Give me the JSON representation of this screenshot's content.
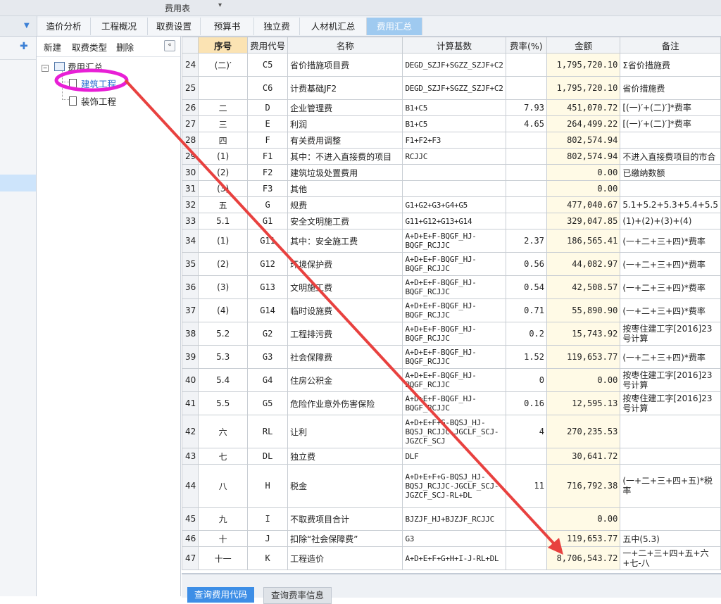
{
  "window": {
    "title": "费用表"
  },
  "tabs": [
    {
      "label": "造价分析"
    },
    {
      "label": "工程概况"
    },
    {
      "label": "取费设置"
    },
    {
      "label": "预算书"
    },
    {
      "label": "独立费"
    },
    {
      "label": "人材机汇总"
    },
    {
      "label": "费用汇总",
      "active": true
    }
  ],
  "tree_toolbar": {
    "new": "新建",
    "fee_type": "取费类型",
    "delete": "删除"
  },
  "tree": {
    "root": "费用汇总",
    "children": [
      "建筑工程",
      "装饰工程"
    ],
    "selected": "建筑工程"
  },
  "table": {
    "headers": [
      "序号",
      "费用代号",
      "名称",
      "计算基数",
      "费率(%)",
      "金额",
      "备注"
    ],
    "rows": [
      {
        "n": "24",
        "seq": "(二)′",
        "code": "C5",
        "name": "省价措施项目费",
        "base": "DEGD_SZJF+SGZZ_SZJF+C2",
        "rate": "",
        "amount": "1,795,720.10",
        "note": "Σ省价措施费"
      },
      {
        "n": "25",
        "seq": "",
        "code": "C6",
        "name": "计费基础JF2",
        "base": "DEGD_SZJF+SGZZ_SZJF+C2",
        "rate": "",
        "amount": "1,795,720.10",
        "note": "省价措施费"
      },
      {
        "n": "26",
        "seq": "二",
        "code": "D",
        "name": "企业管理费",
        "base": "B1+C5",
        "rate": "7.93",
        "amount": "451,070.72",
        "note": "[(一)′+(二)′]*费率"
      },
      {
        "n": "27",
        "seq": "三",
        "code": "E",
        "name": "利润",
        "base": "B1+C5",
        "rate": "4.65",
        "amount": "264,499.22",
        "note": "[(一)′+(二)′]*费率"
      },
      {
        "n": "28",
        "seq": "四",
        "code": "F",
        "name": "有关费用调整",
        "base": "F1+F2+F3",
        "rate": "",
        "amount": "802,574.94",
        "note": ""
      },
      {
        "n": "29",
        "seq": "(1)",
        "code": "F1",
        "name": "其中：不进入直接费的项目",
        "base": "RCJJC",
        "rate": "",
        "amount": "802,574.94",
        "note": "不进入直接费项目的市合"
      },
      {
        "n": "30",
        "seq": "(2)",
        "code": "F2",
        "name": "建筑垃圾处置费用",
        "base": "",
        "rate": "",
        "amount": "0.00",
        "note": "已缴纳数额"
      },
      {
        "n": "31",
        "seq": "(3)",
        "code": "F3",
        "name": "其他",
        "base": "",
        "rate": "",
        "amount": "0.00",
        "note": ""
      },
      {
        "n": "32",
        "seq": "五",
        "code": "G",
        "name": "规费",
        "base": "G1+G2+G3+G4+G5",
        "rate": "",
        "amount": "477,040.67",
        "note": "5.1+5.2+5.3+5.4+5.5"
      },
      {
        "n": "33",
        "seq": "5.1",
        "code": "G1",
        "name": "安全文明施工费",
        "base": "G11+G12+G13+G14",
        "rate": "",
        "amount": "329,047.85",
        "note": "(1)+(2)+(3)+(4)"
      },
      {
        "n": "34",
        "seq": "(1)",
        "code": "G11",
        "name": "其中：安全施工费",
        "base": "A+D+E+F-BQGF_HJ-BQGF_RCJJC",
        "rate": "2.37",
        "amount": "186,565.41",
        "note": "(一+二+三+四)*费率"
      },
      {
        "n": "35",
        "seq": "(2)",
        "code": "G12",
        "name": "环境保护费",
        "base": "A+D+E+F-BQGF_HJ-BQGF_RCJJC",
        "rate": "0.56",
        "amount": "44,082.97",
        "note": "(一+二+三+四)*费率"
      },
      {
        "n": "36",
        "seq": "(3)",
        "code": "G13",
        "name": "文明施工费",
        "base": "A+D+E+F-BQGF_HJ-BQGF_RCJJC",
        "rate": "0.54",
        "amount": "42,508.57",
        "note": "(一+二+三+四)*费率"
      },
      {
        "n": "37",
        "seq": "(4)",
        "code": "G14",
        "name": "临时设施费",
        "base": "A+D+E+F-BQGF_HJ-BQGF_RCJJC",
        "rate": "0.71",
        "amount": "55,890.90",
        "note": "(一+二+三+四)*费率"
      },
      {
        "n": "38",
        "seq": "5.2",
        "code": "G2",
        "name": "工程排污费",
        "base": "A+D+E+F-BQGF_HJ-BQGF_RCJJC",
        "rate": "0.2",
        "amount": "15,743.92",
        "note": "按枣住建工字[2016]23号计算"
      },
      {
        "n": "39",
        "seq": "5.3",
        "code": "G3",
        "name": "社会保障费",
        "base": "A+D+E+F-BQGF_HJ-BQGF_RCJJC",
        "rate": "1.52",
        "amount": "119,653.77",
        "note": "(一+二+三+四)*费率"
      },
      {
        "n": "40",
        "seq": "5.4",
        "code": "G4",
        "name": "住房公积金",
        "base": "A+D+E+F-BQGF_HJ-BQGF_RCJJC",
        "rate": "0",
        "amount": "0.00",
        "note": "按枣住建工字[2016]23号计算"
      },
      {
        "n": "41",
        "seq": "5.5",
        "code": "G5",
        "name": "危险作业意外伤害保险",
        "base": "A+D+E+F-BQGF_HJ-BQGF_RCJJC",
        "rate": "0.16",
        "amount": "12,595.13",
        "note": "按枣住建工字[2016]23号计算"
      },
      {
        "n": "42",
        "seq": "六",
        "code": "RL",
        "name": "让利",
        "base": "A+D+E+F+G-BQSJ_HJ-BQSJ_RCJJC-JGCLF_SCJ-JGZCF_SCJ",
        "rate": "4",
        "amount": "270,235.53",
        "note": ""
      },
      {
        "n": "43",
        "seq": "七",
        "code": "DL",
        "name": "独立费",
        "base": "DLF",
        "rate": "",
        "amount": "30,641.72",
        "note": ""
      },
      {
        "n": "44",
        "seq": "八",
        "code": "H",
        "name": "税金",
        "base": "A+D+E+F+G-BQSJ_HJ-BQSJ_RCJJC-JGCLF_SCJ-JGZCF_SCJ-RL+DL",
        "rate": "11",
        "amount": "716,792.38",
        "note": "(一+二+三+四+五)*税率"
      },
      {
        "n": "45",
        "seq": "九",
        "code": "I",
        "name": "不取费项目合计",
        "base": "BJZJF_HJ+BJZJF_RCJJC",
        "rate": "",
        "amount": "0.00",
        "note": ""
      },
      {
        "n": "46",
        "seq": "十",
        "code": "J",
        "name": "扣除“社会保障费”",
        "base": "G3",
        "rate": "",
        "amount": "119,653.77",
        "note": "五中(5.3)"
      },
      {
        "n": "47",
        "seq": "十一",
        "code": "K",
        "name": "工程造价",
        "base": "A+D+E+F+G+H+I-J-RL+DL",
        "rate": "",
        "amount": "8,706,543.72",
        "note": "一+二+三+四+五+六+七-八"
      }
    ]
  },
  "bottom_buttons": {
    "query_code": "查询费用代码",
    "query_rate": "查询费率信息"
  },
  "colors": {
    "active_tab": "#9fcaf0",
    "amount_bg": "#fffae6",
    "annotation": "#e8413f",
    "highlight_ellipse": "#e81fd6"
  }
}
